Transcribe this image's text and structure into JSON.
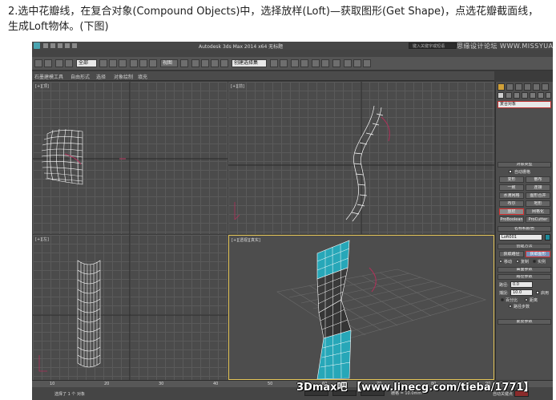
{
  "caption": {
    "line1": "2.选中花瓣线，在复合对象(Compound Objects)中，选择放样(Loft)—获取图形(Get Shape)，点选花瓣截面线，",
    "line2": "生成Loft物体。(下图)"
  },
  "app": {
    "title": "Autodesk 3ds Max 2014 x64     无标题",
    "search_placeholder": "键入关键字或短语",
    "watermark": "思缘设计论坛 WWW.MISSYUAN.COM"
  },
  "toolbar": {
    "selection_filter": "全部",
    "named_selection": "创建选择集",
    "view_dropdown": "视图"
  },
  "ribbon": {
    "tabs": [
      "石墨建模工具",
      "自由形式",
      "选择",
      "对象绘制",
      "填充"
    ]
  },
  "viewports": {
    "top": "[+][顶]",
    "front": "[+][前]",
    "left": "[+][左]",
    "perspective": "[+][透视][真实]"
  },
  "command_panel": {
    "category_dropdown": "复合对象",
    "object_type_title": "对象类型",
    "autogrid": "自动栅格",
    "buttons": [
      [
        "变形",
        "散布"
      ],
      [
        "一致",
        "连接"
      ],
      [
        "水滴网格",
        "图形合并"
      ],
      [
        "布尔",
        "地形"
      ],
      [
        "放样",
        "网格化"
      ],
      [
        "ProBoolean",
        "ProCutter"
      ]
    ],
    "name_color_title": "名称和颜色",
    "object_name": "Loft001",
    "creation_method_title": "创建方法",
    "get_path": "获取路径",
    "get_shape": "获取图形",
    "move": "移动",
    "copy": "复制",
    "instance": "实例",
    "surface_params": "曲面参数",
    "path_params_title": "路径参数",
    "path_label": "路径:",
    "path_value": "0.0",
    "snap_label": "捕捉:",
    "snap_value": "10.0",
    "enable": "启用",
    "percent": "百分比",
    "distance": "距离",
    "path_steps": "路径步数",
    "skin_params": "蒙皮参数"
  },
  "timeline": {
    "ticks": [
      "10",
      "20",
      "30",
      "40",
      "50",
      "60",
      "70",
      "80",
      "90"
    ]
  },
  "status": {
    "selection": "选择了 1 个 对象",
    "grid": "栅格 = 10.0mm",
    "autokey": "自动关键点"
  },
  "watermark_bottom": "3Dmax吧 【www.linecg.com/tieba/1771】",
  "colors": {
    "loft_mesh": "#ffffff",
    "loft_surface": "#27a7b8",
    "path_curve": "#b0315a",
    "highlight": "#d83030",
    "active_viewport": "#e6c75a"
  }
}
